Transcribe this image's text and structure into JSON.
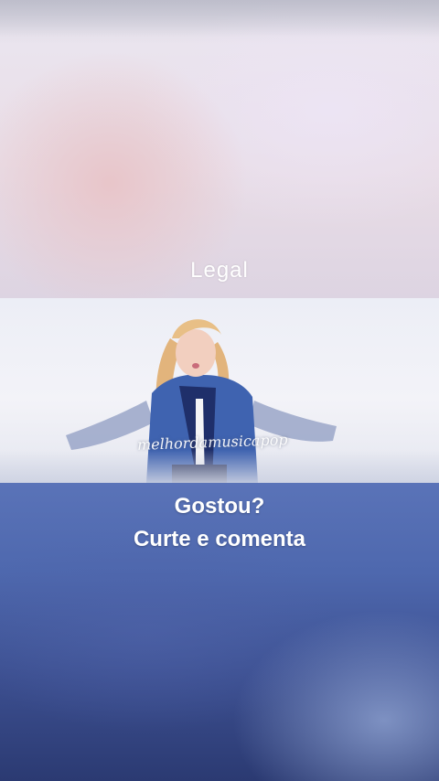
{
  "story": {
    "top_caption": "Legal",
    "video": {
      "watermark": "melhordamusicapop"
    },
    "cta_line1": "Gostou?",
    "cta_line2": "Curte e comenta"
  }
}
